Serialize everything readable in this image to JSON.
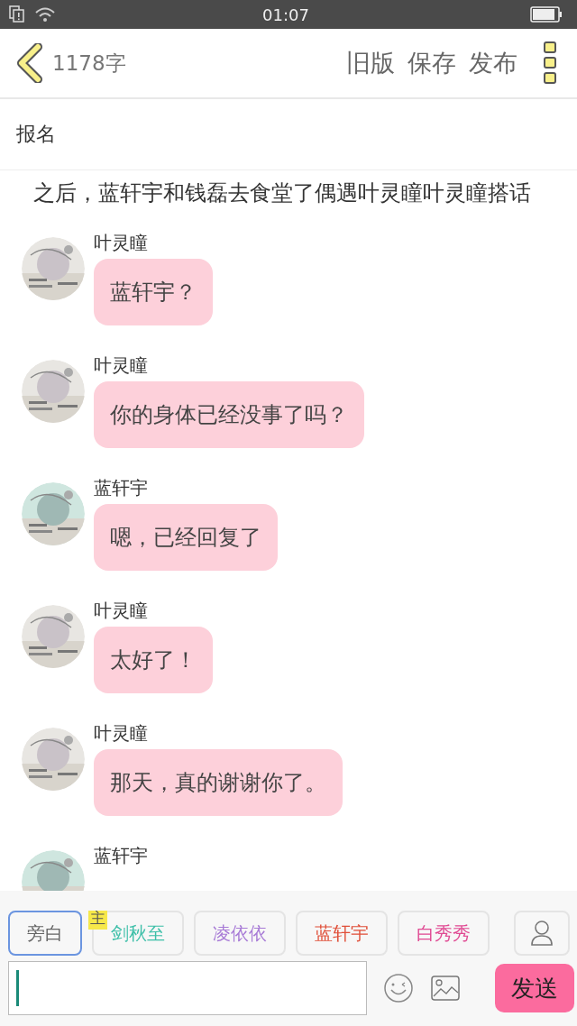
{
  "status_bar": {
    "time": "01:07"
  },
  "header": {
    "word_count": "1178字",
    "actions": [
      "旧版",
      "保存",
      "发布"
    ]
  },
  "chapter_title": "报名",
  "narration": "之后，蓝轩宇和钱磊去食堂了偶遇叶灵瞳叶灵瞳搭话",
  "messages": [
    {
      "name": "叶灵瞳",
      "text": "蓝轩宇？"
    },
    {
      "name": "叶灵瞳",
      "text": "你的身体已经没事了吗？"
    },
    {
      "name": "蓝轩宇",
      "text": "嗯，已经回复了"
    },
    {
      "name": "叶灵瞳",
      "text": "太好了！"
    },
    {
      "name": "叶灵瞳",
      "text": "那天，真的谢谢你了。"
    },
    {
      "name": "蓝轩宇"
    }
  ],
  "characters": [
    {
      "name": "旁白",
      "color": "#666666",
      "selected": true
    },
    {
      "name": "剑秋至",
      "color": "#3cbfa8",
      "selected": false,
      "badge": "主"
    },
    {
      "name": "凌依依",
      "color": "#a77ad6",
      "selected": false
    },
    {
      "name": "蓝轩宇",
      "color": "#e0503a",
      "selected": false
    },
    {
      "name": "白秀秀",
      "color": "#e04a93",
      "selected": false
    }
  ],
  "send_button": "发送"
}
